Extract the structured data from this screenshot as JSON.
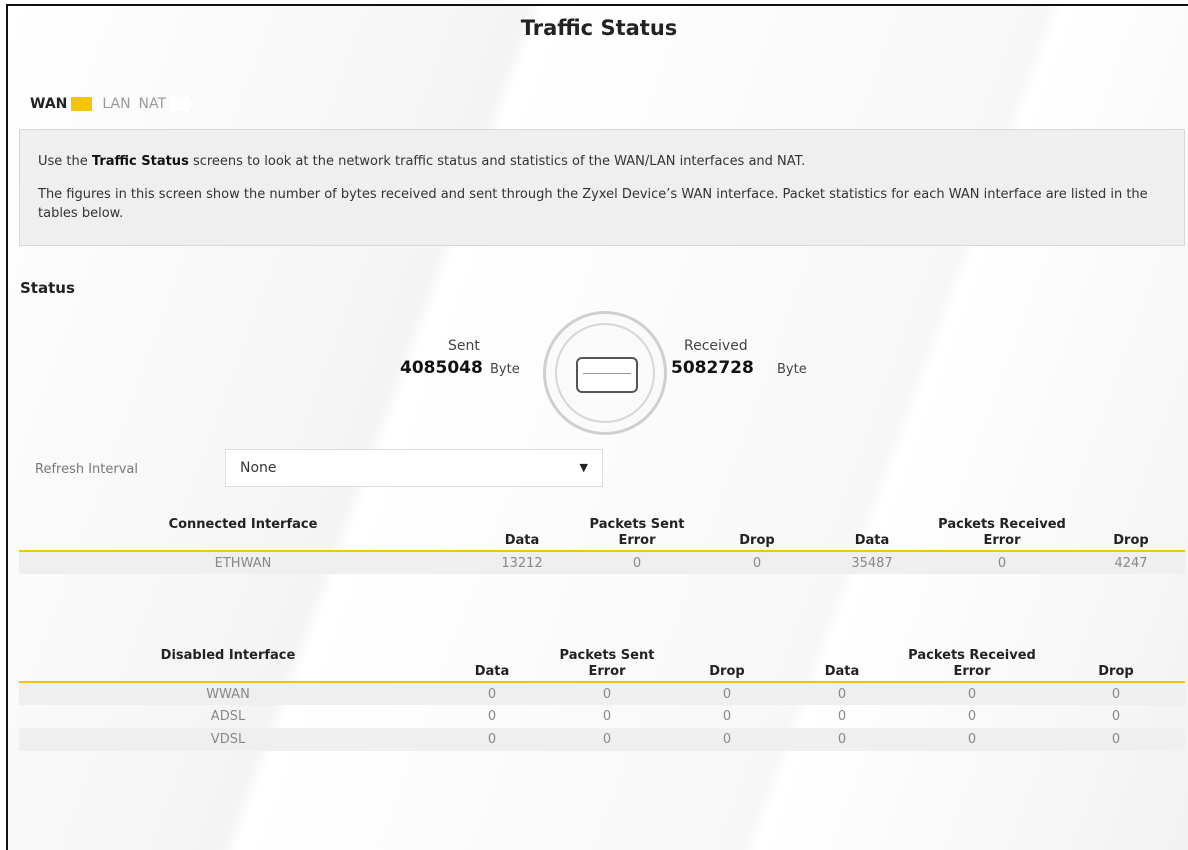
{
  "page": {
    "title": "Traffic Status"
  },
  "tabs": [
    {
      "label": "WAN",
      "active": true
    },
    {
      "label": "LAN",
      "active": false
    },
    {
      "label": "NAT",
      "active": false
    }
  ],
  "info": {
    "p1_bold": "Traffic Status",
    "p1_pre": "Use the ",
    "p1_post": " screens to look at the network traffic status and statistics of the WAN/LAN interfaces and NAT.",
    "p2": "The figures in this screen show the number of bytes received and sent through the Zyxel Device’s WAN interface. Packet statistics for each WAN interface are listed in the tables below."
  },
  "status": {
    "title": "Status",
    "sent_label": "Sent",
    "sent_value": "4085048",
    "sent_unit": "Byte",
    "received_label": "Received",
    "received_value": "5082728",
    "received_unit": "Byte",
    "icon": "router-device-icon"
  },
  "refresh": {
    "label": "Refresh Interval",
    "value": "None"
  },
  "connected_table": {
    "header_interface": "Connected Interface",
    "header_sent": "Packets Sent",
    "header_received": "Packets Received",
    "sub": {
      "data": "Data",
      "error": "Error",
      "drop": "Drop"
    },
    "rows": [
      [
        "ETHWAN",
        "13212",
        "0",
        "0",
        "35487",
        "0",
        "4247"
      ]
    ]
  },
  "disabled_table": {
    "header_interface": "Disabled Interface",
    "header_sent": "Packets Sent",
    "header_received": "Packets Received",
    "sub": {
      "data": "Data",
      "error": "Error",
      "drop": "Drop"
    },
    "rows": [
      [
        "WWAN",
        "0",
        "0",
        "0",
        "0",
        "0",
        "0"
      ],
      [
        "ADSL",
        "0",
        "0",
        "0",
        "0",
        "0",
        "0"
      ],
      [
        "VDSL",
        "0",
        "0",
        "0",
        "0",
        "0",
        "0"
      ]
    ]
  },
  "colors": {
    "accent": "#f5c600",
    "panel": "#efefef"
  }
}
